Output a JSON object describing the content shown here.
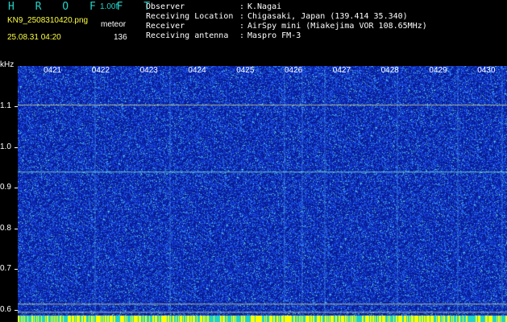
{
  "header": {
    "brand": "H R O F F T",
    "version": "1.00f",
    "filename": "KN9_2508310420.png",
    "meteor_label": "meteor",
    "datetime": "25.08.31 04:20",
    "meteor_count": "136"
  },
  "station": {
    "items": [
      {
        "label": "Observer",
        "value": "K.Nagai"
      },
      {
        "label": "Receiving Location",
        "value": "Chigasaki, Japan (139.414 35.340)"
      },
      {
        "label": "Receiver",
        "value": "AirSpy mini (Miakejima VOR 108.65MHz)"
      },
      {
        "label": "Receiving antenna",
        "value": "Maspro FM-3"
      }
    ],
    "separator": ":"
  },
  "chart_data": {
    "type": "heatmap",
    "ylabel": "kHz",
    "yticks": [
      "1.1",
      "1.0",
      "0.9",
      "0.8",
      "0.7",
      "0.6"
    ],
    "ytick_values": [
      1.1,
      1.0,
      0.9,
      0.8,
      0.7,
      0.6
    ],
    "xticks": [
      "0421",
      "0422",
      "0423",
      "0424",
      "0425",
      "0426",
      "0427",
      "0428",
      "0429",
      "0430"
    ],
    "ylim": [
      0.57,
      1.2
    ],
    "horizontal_lines_khz": [
      1.105,
      0.94,
      0.615,
      0.595
    ],
    "colors": {
      "background": "#0a1fb0",
      "noise": "#2b6cf0",
      "line": "#7fe6c8",
      "bottom_band": "#ffff00",
      "cyan": "#22d2c8"
    }
  }
}
